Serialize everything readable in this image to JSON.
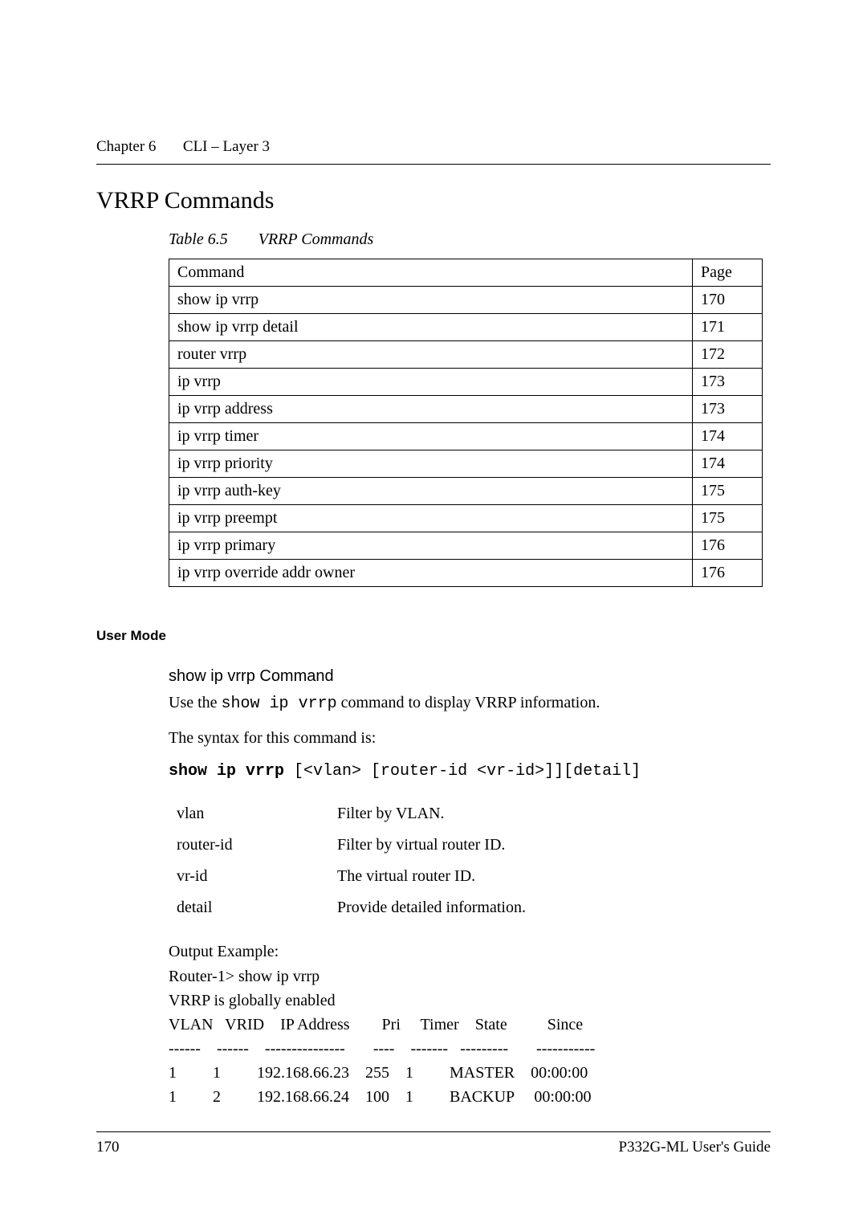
{
  "header": {
    "chapter": "Chapter 6",
    "title": "CLI – Layer 3"
  },
  "section_title": "VRRP Commands",
  "table_caption": {
    "label": "Table 6.5",
    "text": "VRRP Commands"
  },
  "cmd_table": {
    "headers": {
      "command": "Command",
      "page": "Page"
    },
    "rows": [
      {
        "command": "show ip vrrp",
        "page": "170"
      },
      {
        "command": "show ip vrrp detail",
        "page": "171"
      },
      {
        "command": "router vrrp",
        "page": "172"
      },
      {
        "command": "ip vrrp",
        "page": "173"
      },
      {
        "command": "ip vrrp address",
        "page": "173"
      },
      {
        "command": "ip vrrp timer",
        "page": "174"
      },
      {
        "command": "ip vrrp priority",
        "page": "174"
      },
      {
        "command": "ip vrrp auth-key",
        "page": "175"
      },
      {
        "command": "ip vrrp preempt",
        "page": "175"
      },
      {
        "command": "ip vrrp primary",
        "page": "176"
      },
      {
        "command": "ip vrrp override addr owner",
        "page": "176"
      }
    ]
  },
  "mode_label": "User Mode",
  "command_detail": {
    "title": "show ip vrrp Command",
    "use_prefix": "Use the ",
    "use_code": "show ip vrrp",
    "use_suffix": " command to display VRRP information.",
    "syntax_label": "The syntax for this command is:",
    "syntax_bold": "show ip vrrp",
    "syntax_rest": " [<vlan> [router-id <vr-id>]][detail]",
    "params": [
      {
        "k": "vlan",
        "v": "Filter by VLAN."
      },
      {
        "k": "router-id",
        "v": "Filter by virtual router ID."
      },
      {
        "k": "vr-id",
        "v": "The virtual router ID."
      },
      {
        "k": "detail",
        "v": "Provide detailed information."
      }
    ],
    "output_label": "Output Example:",
    "cli": "Router-1> show ip vrrp\nVRRP is globally enabled\nVLAN   VRID    IP Address        Pri     Timer    State          Since\n------    ------    ---------------       ----    -------   ---------       -----------\n1         1         192.168.66.23    255    1         MASTER    00:00:00\n1         2         192.168.66.24    100    1         BACKUP     00:00:00"
  },
  "footer": {
    "page": "170",
    "guide": "P332G-ML User's Guide"
  }
}
